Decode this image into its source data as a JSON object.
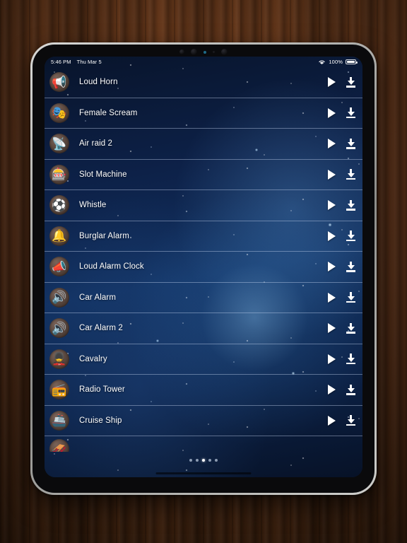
{
  "device": {
    "name": "iPad",
    "sensors": [
      "camera-lens",
      "camera-lens",
      "proximity-sensor",
      "ambient-light-sensor",
      "camera-lens"
    ]
  },
  "statusbar": {
    "time": "5:46 PM",
    "date": "Thu Mar 5",
    "wifi_icon": "wifi-icon",
    "battery_percent": "100%",
    "battery_icon": "battery-full-icon"
  },
  "list": {
    "rows": [
      {
        "label": "Loud Horn",
        "icon": "horn-icon",
        "glyph": "📢",
        "play": "play-button",
        "download": "download-button"
      },
      {
        "label": "Female Scream",
        "icon": "theater-masks-icon",
        "glyph": "🎭",
        "play": "play-button",
        "download": "download-button"
      },
      {
        "label": "Air raid 2",
        "icon": "satellite-dish-icon",
        "glyph": "📡",
        "play": "play-button",
        "download": "download-button"
      },
      {
        "label": "Slot Machine",
        "icon": "slot-machine-icon",
        "glyph": "🎰",
        "play": "play-button",
        "download": "download-button"
      },
      {
        "label": "Whistle",
        "icon": "soccer-ball-icon",
        "glyph": "⚽",
        "play": "play-button",
        "download": "download-button"
      },
      {
        "label": "Burglar Alarm",
        "icon": "bell-icon",
        "glyph": "🔔",
        "play": "play-button",
        "download": "download-button"
      },
      {
        "label": "Loud Alarm Clock",
        "icon": "megaphone-icon",
        "glyph": "📣",
        "play": "play-button",
        "download": "download-button"
      },
      {
        "label": "Car Alarm",
        "icon": "loudspeaker-icon",
        "glyph": "🔊",
        "play": "play-button",
        "download": "download-button"
      },
      {
        "label": "Car Alarm 2",
        "icon": "speaker-waves-icon",
        "glyph": "🔊",
        "play": "play-button",
        "download": "download-button"
      },
      {
        "label": "Cavalry",
        "icon": "guard-icon",
        "glyph": "💂",
        "play": "play-button",
        "download": "download-button"
      },
      {
        "label": "Radio Tower",
        "icon": "radio-icon",
        "glyph": "📻",
        "play": "play-button",
        "download": "download-button"
      },
      {
        "label": "Cruise Ship",
        "icon": "ship-icon",
        "glyph": "🚢",
        "play": "play-button",
        "download": "download-button"
      }
    ],
    "clipped_row": {
      "label": "",
      "icon": "sled-icon",
      "glyph": "🛷"
    }
  },
  "page_dots": {
    "count": 5,
    "active_index": 2
  },
  "home_indicator": "home-indicator",
  "colors": {
    "screen_bg": "#11305f",
    "text": "#ffffff",
    "separator": "rgba(200,215,240,0.42)",
    "desk": "#5e331a",
    "device_frame": "#b9b9b6"
  }
}
